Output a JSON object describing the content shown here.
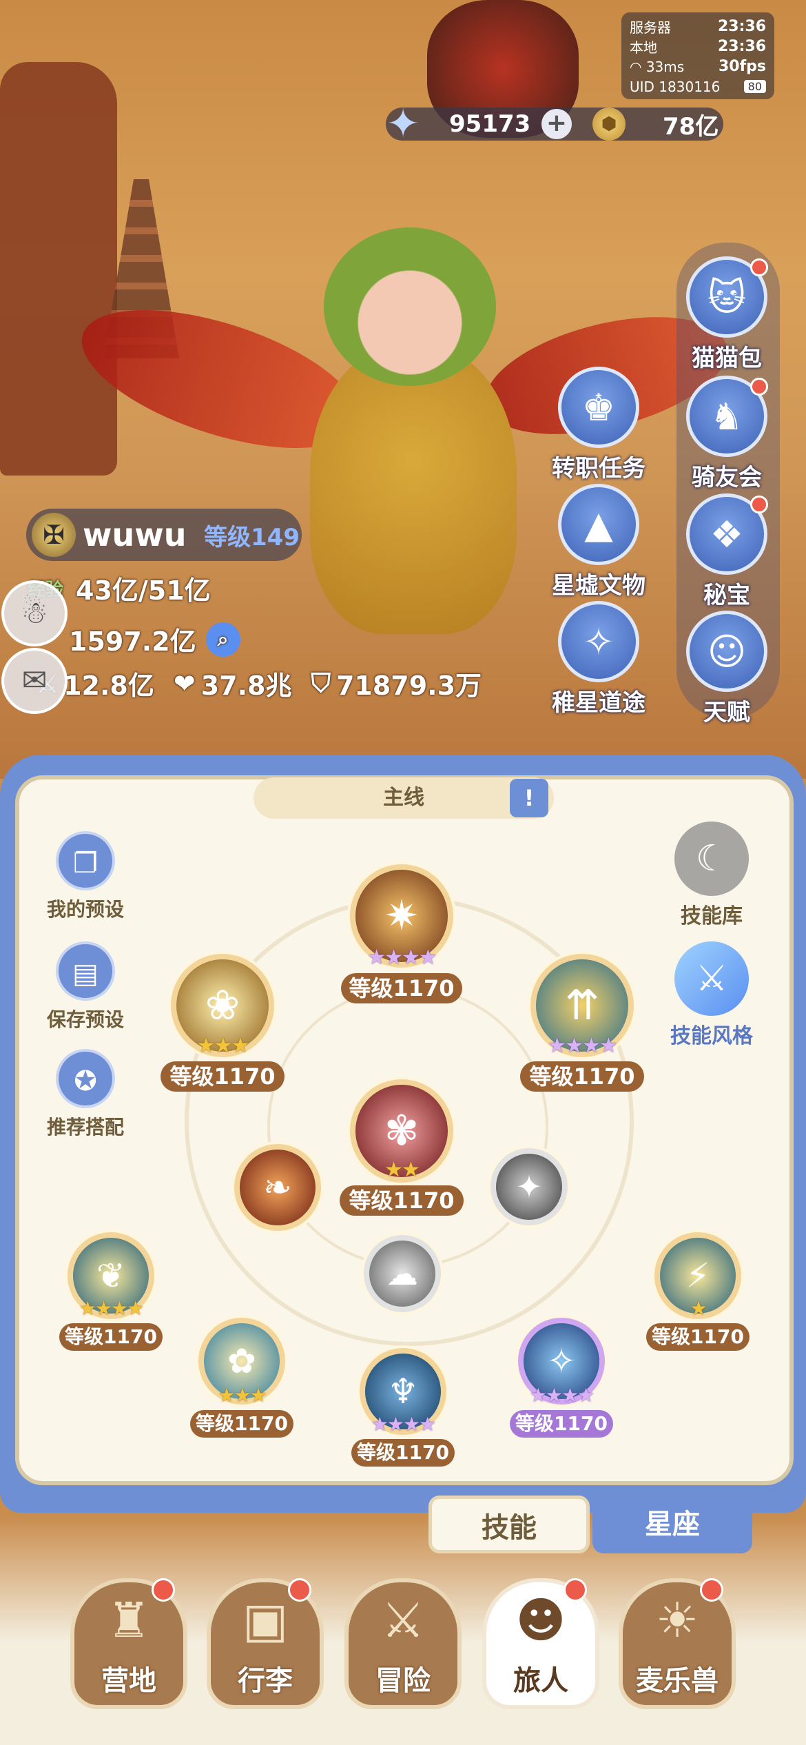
{
  "hud": {
    "server_label": "服务器",
    "server_time": "23:36",
    "local_label": "本地",
    "local_time": "23:36",
    "ping": "33ms",
    "fps": "30fps",
    "uid": "UID 1830116",
    "uid_badge": "80"
  },
  "currency": {
    "stars": "95173",
    "plus": "+",
    "coins": "78亿"
  },
  "side_menu": [
    {
      "label": "猫猫包",
      "icon": "cat-bag-icon",
      "has_dot": true
    },
    {
      "label": "骑友会",
      "icon": "horse-icon",
      "has_dot": true
    },
    {
      "label": "秘宝",
      "icon": "treasure-chest-icon",
      "has_dot": true
    },
    {
      "label": "天赋",
      "icon": "brain-head-icon",
      "has_dot": false
    }
  ],
  "mid_menu": [
    {
      "label": "转职任务",
      "icon": "job-change-icon"
    },
    {
      "label": "星墟文物",
      "icon": "mountain-relic-icon"
    },
    {
      "label": "稚星道途",
      "icon": "star-path-icon"
    }
  ],
  "player": {
    "name": "wuwu",
    "level": "等级149",
    "exp_label": "经验",
    "exp": "43亿/51亿",
    "power": "1597.2亿",
    "attack": "12.8亿",
    "hp": "37.8兆",
    "defense": "71879.3万"
  },
  "panel": {
    "mainline": "主线",
    "left_tools": [
      "我的预设",
      "保存预设",
      "推荐搭配"
    ],
    "right_tools": [
      "技能库",
      "技能风格"
    ]
  },
  "skills": [
    {
      "id": "top",
      "level": "等级1170",
      "stars": "★★★★",
      "star_color": "purple"
    },
    {
      "id": "upper-left",
      "level": "等级1170",
      "stars": "★★★",
      "star_color": "gold"
    },
    {
      "id": "upper-right",
      "level": "等级1170",
      "stars": "★★★★",
      "star_color": "purple"
    },
    {
      "id": "center",
      "level": "等级1170",
      "stars": "★★",
      "star_color": "gold"
    },
    {
      "id": "lower-left",
      "level": "等级1170",
      "stars": "★★★★",
      "star_color": "gold"
    },
    {
      "id": "lower-mid-left",
      "level": "等级1170",
      "stars": "★★★",
      "star_color": "gold"
    },
    {
      "id": "bottom",
      "level": "等级1170",
      "stars": "★★★★",
      "star_color": "purple"
    },
    {
      "id": "lower-mid-right",
      "level": "等级1170",
      "stars": "★★★★",
      "star_color": "purple",
      "tag_color": "purple"
    },
    {
      "id": "lower-right",
      "level": "等级1170",
      "stars": "★",
      "star_color": "gold"
    }
  ],
  "sub_tabs": {
    "skill": "技能",
    "constellation": "星座"
  },
  "nav": [
    {
      "label": "营地",
      "icon": "castle-icon",
      "has_dot": true
    },
    {
      "label": "行李",
      "icon": "luggage-icon",
      "has_dot": true
    },
    {
      "label": "冒险",
      "icon": "crossed-swords-icon",
      "has_dot": false
    },
    {
      "label": "旅人",
      "icon": "traveler-avatar-icon",
      "has_dot": true,
      "active": true
    },
    {
      "label": "麦乐兽",
      "icon": "fox-pet-icon",
      "has_dot": true
    }
  ]
}
